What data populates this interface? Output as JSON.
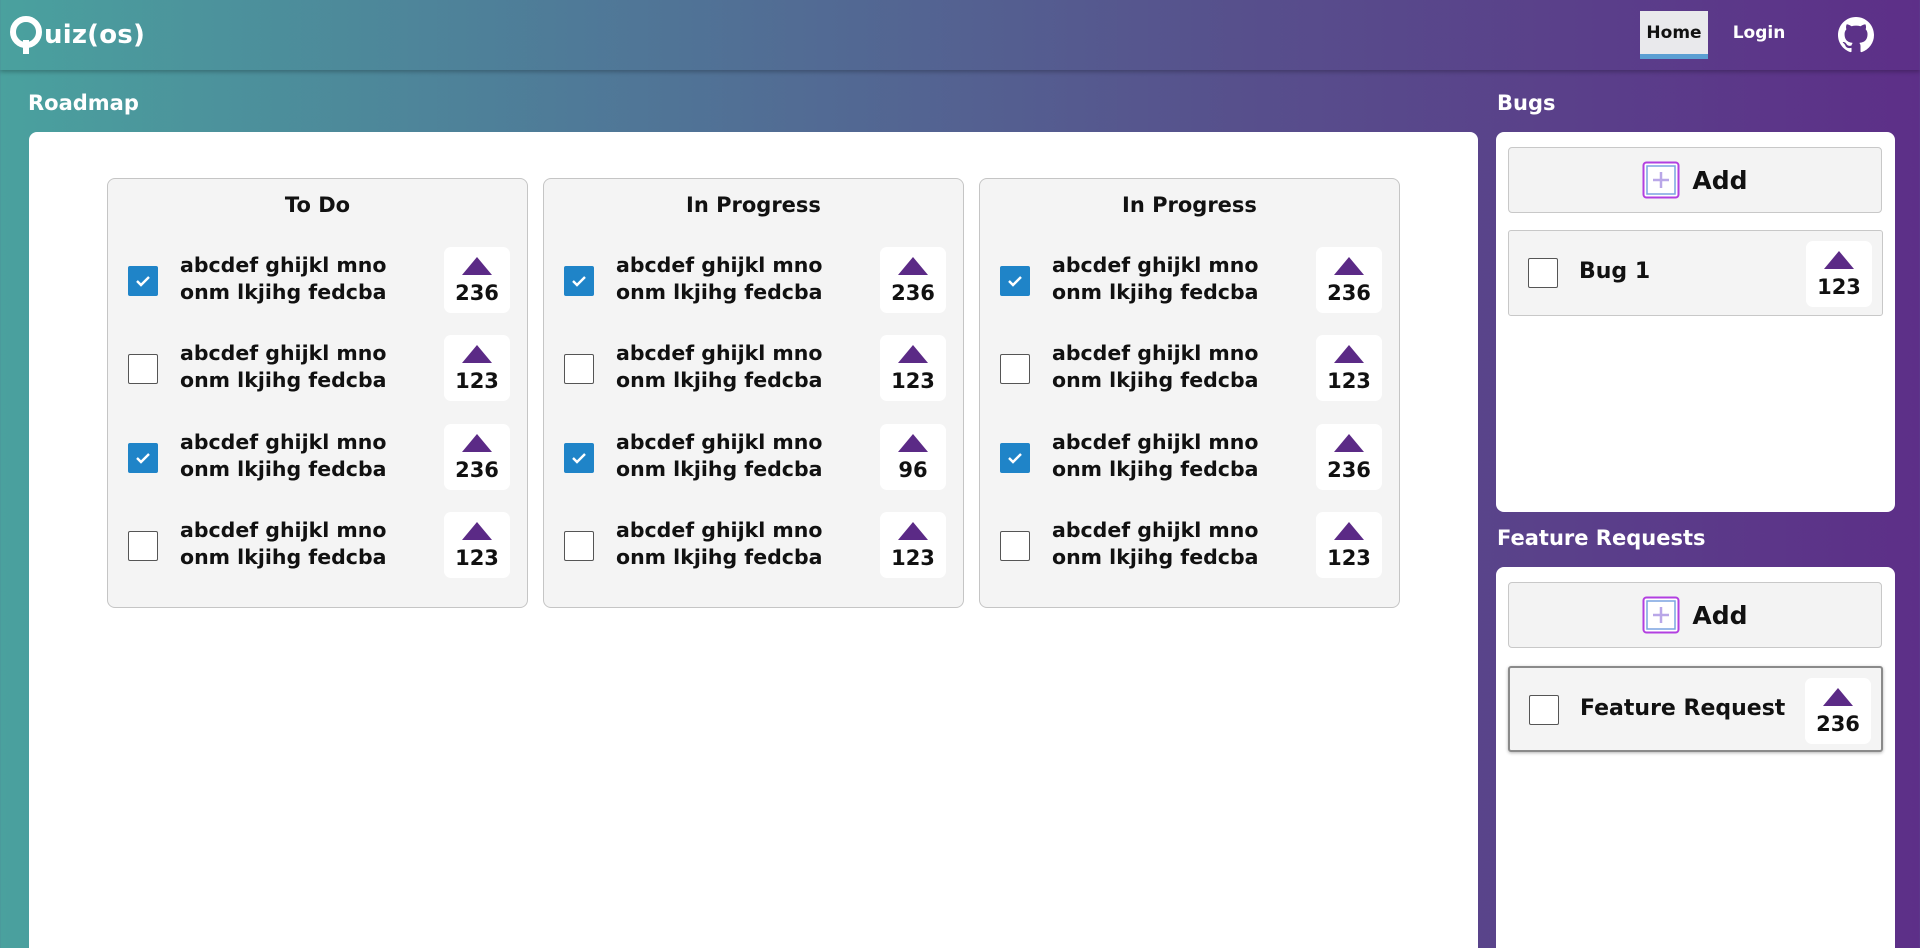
{
  "header": {
    "logo_text": "uiz(os)",
    "nav": {
      "home": "Home",
      "login": "Login"
    }
  },
  "roadmap": {
    "title": "Roadmap",
    "columns": [
      {
        "title": "To Do",
        "items": [
          {
            "text": "abcdef ghijkl mno onm lkjihg fedcba",
            "checked": true,
            "votes": "236"
          },
          {
            "text": "abcdef ghijkl mno onm lkjihg fedcba",
            "checked": false,
            "votes": "123"
          },
          {
            "text": "abcdef ghijkl mno onm lkjihg fedcba",
            "checked": true,
            "votes": "236"
          },
          {
            "text": "abcdef ghijkl mno onm lkjihg fedcba",
            "checked": false,
            "votes": "123"
          }
        ]
      },
      {
        "title": "In Progress",
        "items": [
          {
            "text": "abcdef ghijkl mno onm lkjihg fedcba",
            "checked": true,
            "votes": "236"
          },
          {
            "text": "abcdef ghijkl mno onm lkjihg fedcba",
            "checked": false,
            "votes": "123"
          },
          {
            "text": "abcdef ghijkl mno onm lkjihg fedcba",
            "checked": true,
            "votes": "96"
          },
          {
            "text": "abcdef ghijkl mno onm lkjihg fedcba",
            "checked": false,
            "votes": "123"
          }
        ]
      },
      {
        "title": "In Progress",
        "items": [
          {
            "text": "abcdef ghijkl mno onm lkjihg fedcba",
            "checked": true,
            "votes": "236"
          },
          {
            "text": "abcdef ghijkl mno onm lkjihg fedcba",
            "checked": false,
            "votes": "123"
          },
          {
            "text": "abcdef ghijkl mno onm lkjihg fedcba",
            "checked": true,
            "votes": "236"
          },
          {
            "text": "abcdef ghijkl mno onm lkjihg fedcba",
            "checked": false,
            "votes": "123"
          }
        ]
      }
    ]
  },
  "bugs": {
    "title": "Bugs",
    "add_label": "Add",
    "items": [
      {
        "label": "Bug 1",
        "checked": false,
        "votes": "123"
      }
    ]
  },
  "feature_requests": {
    "title": "Feature Requests",
    "add_label": "Add",
    "items": [
      {
        "label": "Feature Request",
        "checked": false,
        "votes": "236"
      }
    ]
  },
  "colors": {
    "checkbox_checked": "#1f84c8",
    "upvote_arrow": "#5b2a86",
    "add_icon_border": "#b23fe0",
    "nav_active_underline": "#5b9fd3"
  },
  "icons": {
    "logo": "q-logo-icon",
    "github": "github-icon",
    "upvote": "upvote-arrow-icon",
    "add": "plus-square-icon",
    "check": "check-icon"
  }
}
